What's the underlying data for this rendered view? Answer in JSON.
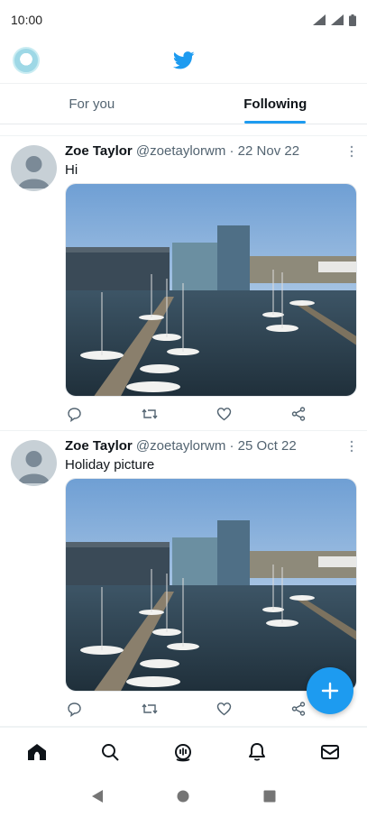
{
  "status_bar": {
    "time": "10:00",
    "icons": [
      "wifi-icon",
      "signal-icon",
      "battery-icon"
    ]
  },
  "top_bar": {
    "logo": "twitter-bird-icon",
    "avatar": "profile-avatar"
  },
  "tabs": [
    {
      "label": "For you",
      "active": false
    },
    {
      "label": "Following",
      "active": true
    }
  ],
  "tweets": [
    {
      "name": "Zoe Taylor",
      "meta": "@zoetaylorwm · 22 Nov 22",
      "text": "Hi"
    },
    {
      "name": "Zoe Taylor",
      "meta": "@zoetaylorwm · 25 Oct 22",
      "text": "Holiday picture"
    }
  ],
  "actions": [
    "reply-icon",
    "retweet-icon",
    "like-icon",
    "share-icon"
  ],
  "bottom_nav": [
    "home-icon",
    "search-icon",
    "spaces-icon",
    "notifications-icon",
    "messages-icon"
  ],
  "system_nav": [
    "back-icon",
    "home-circle-icon",
    "recents-icon"
  ],
  "colors": {
    "accent": "#1d9bf0",
    "text": "#0f1419",
    "muted": "#536471"
  }
}
